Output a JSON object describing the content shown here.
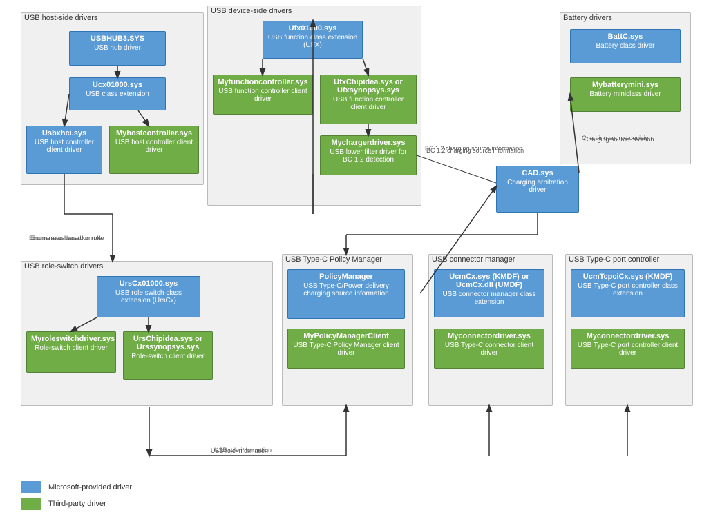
{
  "groups": {
    "host_drivers": {
      "label": "USB host-side drivers"
    },
    "device_drivers": {
      "label": "USB device-side drivers"
    },
    "battery_drivers": {
      "label": "Battery drivers"
    },
    "role_switch": {
      "label": "USB role-switch drivers"
    },
    "policy_manager": {
      "label": "USB Type-C Policy Manager"
    },
    "connector_manager": {
      "label": "USB connector manager"
    },
    "port_controller": {
      "label": "USB Type-C port controller"
    }
  },
  "boxes": {
    "usbhub3": {
      "title": "USBHUB3.SYS",
      "desc": "USB hub driver"
    },
    "ucx01000": {
      "title": "Ucx01000.sys",
      "desc": "USB class extension"
    },
    "usbxhci": {
      "title": "Usbxhci.sys",
      "desc": "USB host controller client driver"
    },
    "myhostcontroller": {
      "title": "Myhostcontroller.sys",
      "desc": "USB host controller client driver"
    },
    "ufx01000": {
      "title": "Ufx01000.sys",
      "desc": "USB function class extension (UFX)"
    },
    "myfunctioncontroller": {
      "title": "Myfunctioncontroller.sys",
      "desc": "USB function controller client driver"
    },
    "ufxchipidea": {
      "title": "UfxChipidea.sys or Ufxsynopsys.sys",
      "desc": "USB function controller client driver"
    },
    "mychargerdriver": {
      "title": "Mychargerdriver.sys",
      "desc": "USB lower filter driver for BC 1.2 detection"
    },
    "battc": {
      "title": "BattC.sys",
      "desc": "Battery class driver"
    },
    "mybatterymini": {
      "title": "Mybatterymini.sys",
      "desc": "Battery miniclass driver"
    },
    "cad": {
      "title": "CAD.sys",
      "desc": "Charging arbitration driver"
    },
    "urscx01000": {
      "title": "UrsCx01000.sys",
      "desc": "USB role switch class extension (UrsCx)"
    },
    "myroleswitchdriver": {
      "title": "Myroleswitchdriver.sys",
      "desc": "Role-switch client driver"
    },
    "urschipidea": {
      "title": "UrsChipidea.sys or Urssynopsys.sys",
      "desc": "Role-switch client driver"
    },
    "policymanager": {
      "title": "PolicyManager",
      "desc": "USB Type-C/Power delivery charging source information"
    },
    "mypolicymanagerclient": {
      "title": "MyPolicyManagerClient",
      "desc": "USB Type-C Policy Manager client driver"
    },
    "ucmcx": {
      "title": "UcmCx.sys (KMDF) or UcmCx.dll (UMDF)",
      "desc": "USB connector manager class extension"
    },
    "myconnectordriver1": {
      "title": "Myconnectordriver.sys",
      "desc": "USB Type-C connector client driver"
    },
    "ucmtcpcicx": {
      "title": "UcmTcpciCx.sys (KMDF)",
      "desc": "USB Type-C port controller class extension"
    },
    "myconnectordriver2": {
      "title": "Myconnectordriver.sys",
      "desc": "USB Type-C port controller client driver"
    }
  },
  "arrows": {
    "bc12_label": "BC 1.2 charging source information",
    "charging_decision_label": "Charging source decision",
    "enumerates_label": "Enumerates based on role",
    "role_info_label": "USB role information"
  },
  "legend": {
    "microsoft": "Microsoft-provided driver",
    "thirdparty": "Third-party driver",
    "microsoft_color": "#5b9bd5",
    "thirdparty_color": "#70ad47"
  }
}
